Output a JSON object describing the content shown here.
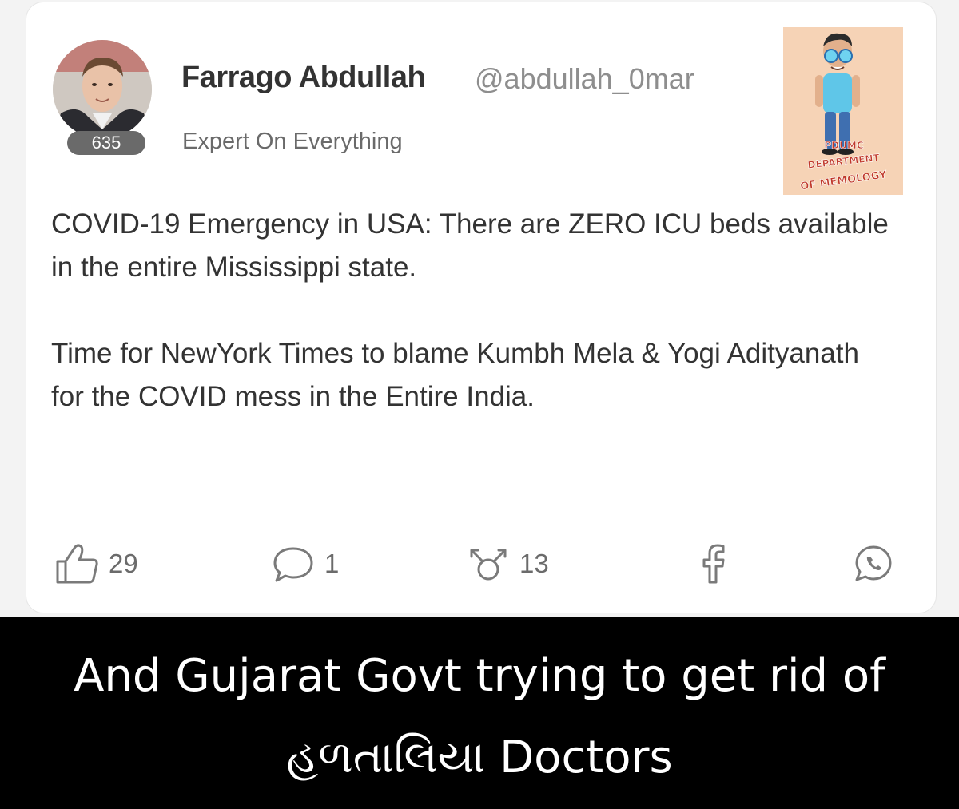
{
  "post": {
    "author": {
      "display_name": "Farrago Abdullah",
      "handle": "@abdullah_0mar",
      "reputation": "635",
      "title": "Expert On Everything"
    },
    "body": [
      "COVID-19 Emergency in USA: There are ZERO ICU beds available in the entire Mississippi state.",
      "Time for NewYork Times to blame Kumbh Mela & Yogi Adityanath for the COVID mess in the Entire India."
    ],
    "actions": {
      "like": {
        "icon": "thumbs-up-icon",
        "count": "29"
      },
      "comment": {
        "icon": "comment-bubble-icon",
        "count": "1"
      },
      "share": {
        "icon": "share-icon",
        "count": "13"
      },
      "facebook": {
        "icon": "facebook-icon"
      },
      "whatsapp": {
        "icon": "whatsapp-icon"
      }
    }
  },
  "stamp": {
    "line1": "PDUMC",
    "line2": "DEPARTMENT",
    "line3": "OF MEMOLOGY"
  },
  "caption": {
    "line1": "And Gujarat Govt trying to get rid of",
    "line2": "હળતાલિયા Doctors"
  },
  "colors": {
    "name": "#333333",
    "muted": "#8e8e8e",
    "icon": "#7a7a7a",
    "caption_bg": "#000000",
    "stamp_bg": "#f6d3b6",
    "stamp_text": "#c0392b"
  }
}
